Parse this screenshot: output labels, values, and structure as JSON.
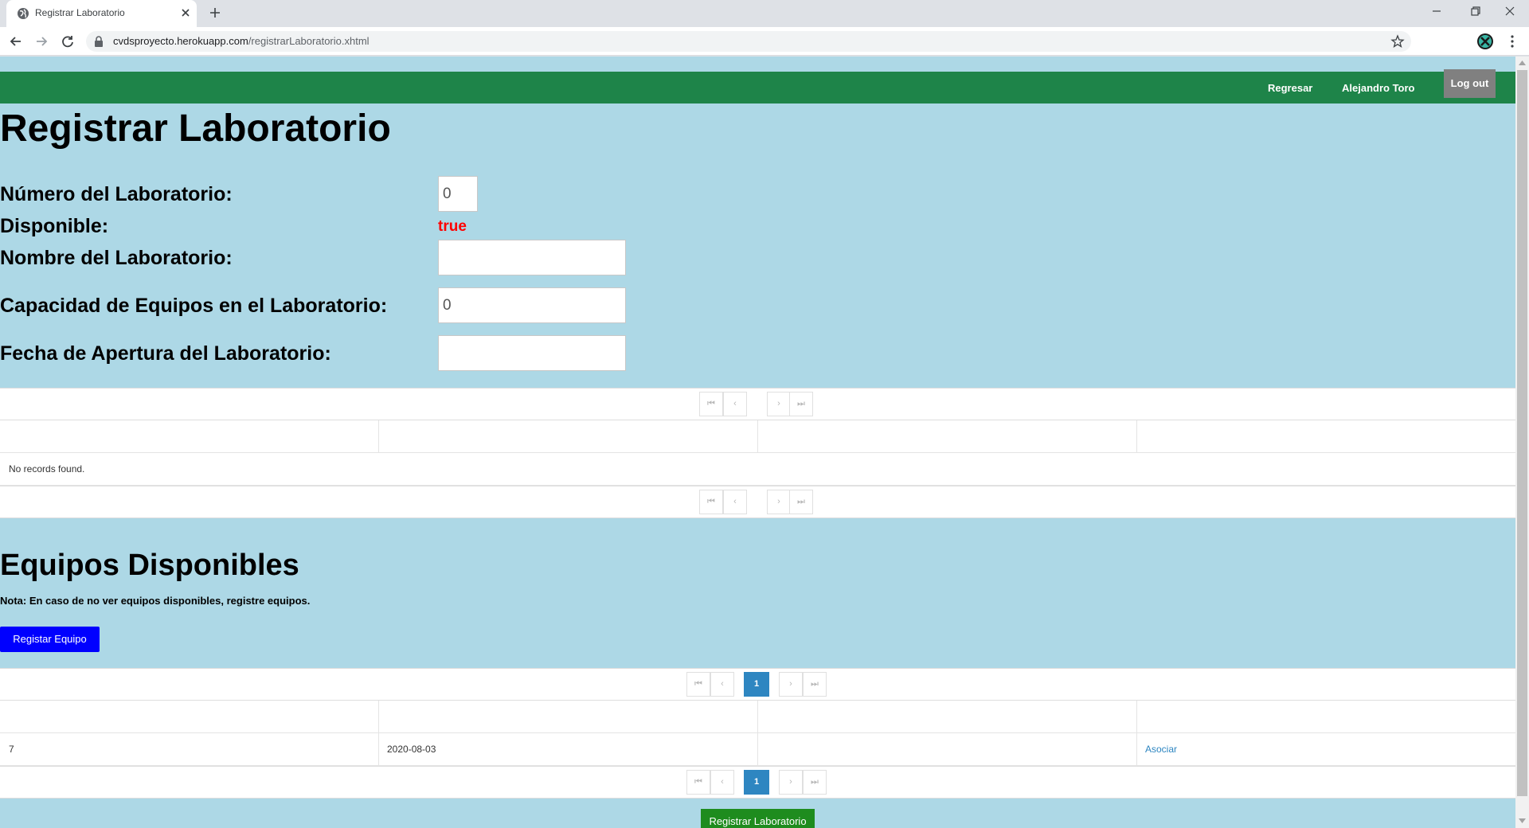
{
  "browser": {
    "tab_title": "Registrar Laboratorio",
    "url_host": "cvdsproyecto.herokuapp.com",
    "url_path": "/registrarLaboratorio.xhtml"
  },
  "navbar": {
    "back_link": "Regresar",
    "user_name": "Alejandro Toro",
    "logout_label": "Log out"
  },
  "form": {
    "title": "Registrar Laboratorio",
    "number_label": "Número del Laboratorio:",
    "number_value": "0",
    "available_label": "Disponible:",
    "available_value": "true",
    "name_label": "Nombre del Laboratorio:",
    "name_value": "",
    "capacity_label": "Capacidad de Equipos en el Laboratorio:",
    "capacity_value": "0",
    "date_label": "Fecha de Apertura del Laboratorio:",
    "date_value": ""
  },
  "lab_table": {
    "empty_message": "No records found.",
    "pager": {
      "first": "⏮",
      "prev": "‹",
      "next": "›",
      "last": "⏭"
    }
  },
  "equipment": {
    "title": "Equipos Disponibles",
    "note": "Nota: En caso de no ver equipos disponibles, registre equipos.",
    "register_button": "Registar Equipo",
    "current_page": "1",
    "rows": [
      {
        "id": "7",
        "date": "2020-08-03",
        "col3": "",
        "action": "Asociar"
      }
    ]
  },
  "submit_button": "Registrar Laboratorio",
  "colors": {
    "navbar": "#1e8449",
    "page_bg": "#add8e6",
    "available_value": "#ff0000",
    "primary_button": "#0000ff",
    "submit_button": "#1e8c1e",
    "pager_active": "#2e86c1"
  }
}
